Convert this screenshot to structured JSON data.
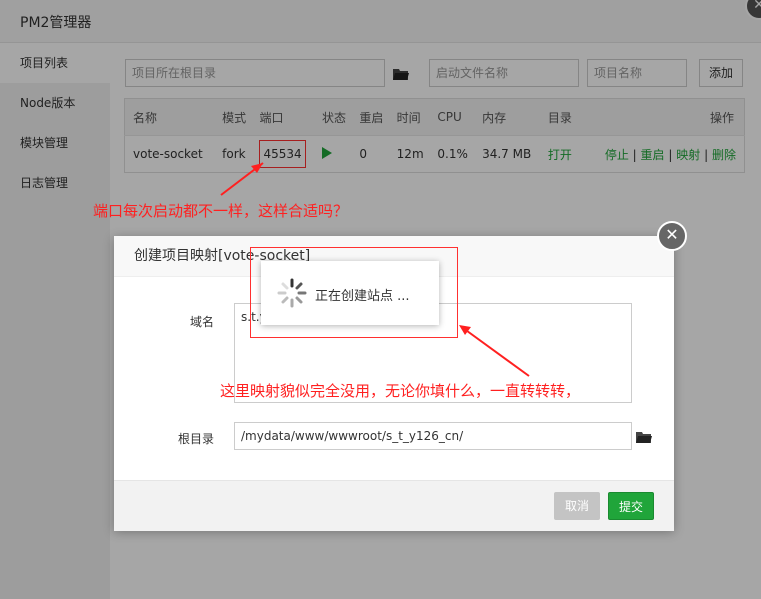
{
  "window": {
    "title": "PM2管理器",
    "close": "✕"
  },
  "sidebar": {
    "items": [
      {
        "label": "项目列表"
      },
      {
        "label": "Node版本"
      },
      {
        "label": "模块管理"
      },
      {
        "label": "日志管理"
      }
    ]
  },
  "toolbar": {
    "root_placeholder": "项目所在根目录",
    "start_placeholder": "启动文件名称",
    "name_placeholder": "项目名称",
    "add_label": "添加"
  },
  "table": {
    "headers": [
      "名称",
      "模式",
      "端口",
      "状态",
      "重启",
      "时间",
      "CPU",
      "内存",
      "目录",
      "操作"
    ],
    "row": {
      "name": "vote-socket",
      "mode": "fork",
      "port": "45534",
      "restart": "0",
      "time": "12m",
      "cpu": "0.1%",
      "memory": "34.7 MB",
      "dir": "打开",
      "actions": [
        "停止",
        "重启",
        "映射",
        "删除"
      ],
      "sep": "|"
    }
  },
  "annotations": {
    "port_note": "端口每次启动都不一样，这样合适吗？",
    "mapping_note": "这里映射貌似完全没用，无论你填什么，一直转转转，"
  },
  "dialog": {
    "title": "创建项目映射[vote-socket]",
    "close": "✕",
    "domain_label": "域名",
    "domain_value": "s.t.y",
    "root_label": "根目录",
    "root_value": "/mydata/www/wwwroot/s_t_y126_cn/",
    "cancel_label": "取消",
    "submit_label": "提交"
  },
  "loading": {
    "text": "正在创建站点 ..."
  },
  "colors": {
    "accent_green": "#20a53a",
    "annotation_red": "#ff2020"
  }
}
